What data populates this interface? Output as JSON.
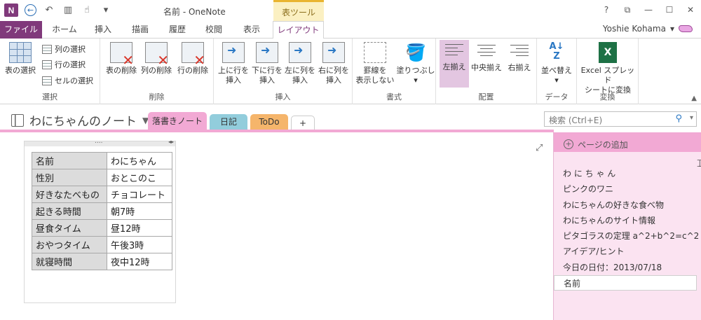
{
  "window": {
    "title": "名前 - OneNote",
    "context_tab": "表ツール",
    "controls": [
      "?",
      "⧉",
      "—",
      "☐",
      "✕"
    ]
  },
  "qat": {
    "logo": "N"
  },
  "ribbon_tabs": [
    "ファイル",
    "ホーム",
    "挿入",
    "描画",
    "履歴",
    "校閲",
    "表示",
    "レイアウト"
  ],
  "user": {
    "name": "Yoshie Kohama"
  },
  "ribbon": {
    "select_group": {
      "label": "選択",
      "select_table": "表の選択",
      "select_column": "列の選択",
      "select_row": "行の選択",
      "select_cell": "セルの選択"
    },
    "delete_group": {
      "label": "削除",
      "delete_table": "表の削除",
      "delete_column": "列の削除",
      "delete_row": "行の削除"
    },
    "insert_group": {
      "label": "挿入",
      "insert_above": [
        "上に行を",
        "挿入"
      ],
      "insert_below": [
        "下に行を",
        "挿入"
      ],
      "insert_left": [
        "左に列を",
        "挿入"
      ],
      "insert_right": [
        "右に列を",
        "挿入"
      ]
    },
    "format_group": {
      "label": "書式",
      "hide_borders": [
        "罫線を",
        "表示しない"
      ],
      "shading": "塗りつぶし"
    },
    "align_group": {
      "label": "配置",
      "left": "左揃え",
      "center": "中央揃え",
      "right": "右揃え"
    },
    "data_group": {
      "label": "データ",
      "sort": "並べ替え"
    },
    "convert_group": {
      "label": "変換",
      "excel": [
        "Excel スプレッド",
        "シートに変換"
      ]
    }
  },
  "notebook": {
    "name": "わにちゃんのノート",
    "sections": [
      {
        "label": "落書きノート",
        "color": "#f2a9d4"
      },
      {
        "label": "日記",
        "color": "#92cddc"
      },
      {
        "label": "ToDo",
        "color": "#f5b56b"
      },
      {
        "label": "+",
        "color": "#ffffff"
      }
    ],
    "search_placeholder": "検索 (Ctrl+E)"
  },
  "table": [
    [
      "名前",
      "わにちゃん"
    ],
    [
      "性別",
      "おとこのこ"
    ],
    [
      "好きなたべもの",
      "チョコレート"
    ],
    [
      "起きる時間",
      "朝7時"
    ],
    [
      "昼食タイム",
      "昼12時"
    ],
    [
      "おやつタイム",
      "午後3時"
    ],
    [
      "就寝時間",
      "夜中12時"
    ]
  ],
  "pagelist": {
    "add_label": "ページの追加",
    "pages": [
      "わ に ち ゃ ん",
      "ピンクのワニ",
      "わにちゃんの好きな食べ物",
      "わにちゃんのサイト情報",
      "ピタゴラスの定理 a^2+b^2=c^2",
      "アイデア/ヒント",
      "今日の日付：2013/07/18",
      "名前"
    ]
  }
}
